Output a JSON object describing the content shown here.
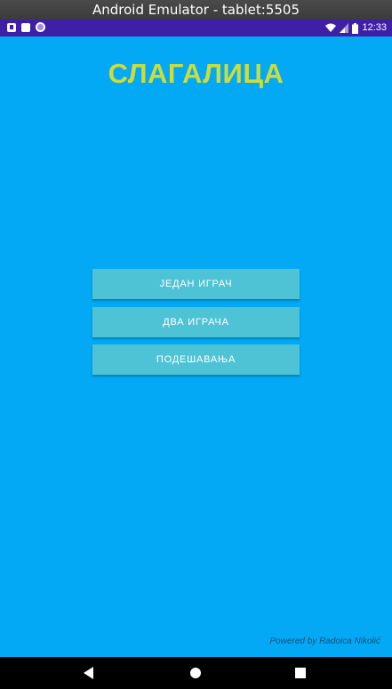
{
  "window": {
    "title": "Android Emulator - tablet:5505"
  },
  "status_bar": {
    "time": "12:33",
    "icons_left": [
      "a-notification-icon",
      "sd-card-icon",
      "record-icon"
    ],
    "icons_right": [
      "wifi-icon",
      "signal-icon",
      "battery-icon"
    ]
  },
  "app": {
    "title": "СЛАГАЛИЦА",
    "buttons": {
      "single_player": "ЈЕДАН ИГРАЧ",
      "two_players": "ДВА ИГРАЧА",
      "settings": "ПОДЕШАВАЊА"
    },
    "footer": "Powered by Radoica Nikolić"
  },
  "navigation": {
    "back": "back-icon",
    "home": "home-icon",
    "recents": "recents-icon"
  },
  "colors": {
    "background": "#03a9f4",
    "title": "#cddc39",
    "button": "#4fc3d6",
    "status_bar": "#3f1fa6"
  }
}
